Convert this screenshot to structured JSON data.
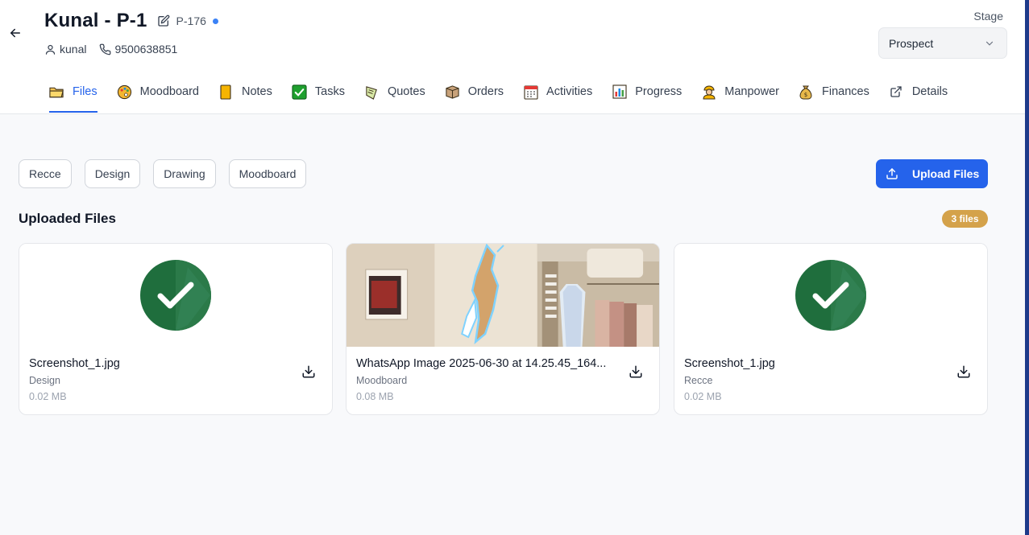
{
  "project": {
    "title": "Kunal - P-1",
    "code": "P-176",
    "user": "kunal",
    "phone": "9500638851"
  },
  "stage": {
    "label": "Stage",
    "value": "Prospect"
  },
  "tabs": [
    {
      "label": "Files",
      "icon": "folder-icon"
    },
    {
      "label": "Moodboard",
      "icon": "palette-icon"
    },
    {
      "label": "Notes",
      "icon": "note-icon"
    },
    {
      "label": "Tasks",
      "icon": "check-box-icon"
    },
    {
      "label": "Quotes",
      "icon": "quotes-icon"
    },
    {
      "label": "Orders",
      "icon": "package-icon"
    },
    {
      "label": "Activities",
      "icon": "calendar-icon"
    },
    {
      "label": "Progress",
      "icon": "bar-chart-icon"
    },
    {
      "label": "Manpower",
      "icon": "worker-icon"
    },
    {
      "label": "Finances",
      "icon": "money-bag-icon"
    },
    {
      "label": "Details",
      "icon": "external-link-icon"
    }
  ],
  "filters": [
    "Recce",
    "Design",
    "Drawing",
    "Moodboard"
  ],
  "upload_label": "Upload Files",
  "section_title": "Uploaded Files",
  "file_count": "3 files",
  "files": [
    {
      "name": "Screenshot_1.jpg",
      "category": "Design",
      "size": "0.02 MB",
      "thumb": "check-badge"
    },
    {
      "name": "WhatsApp Image 2025-06-30 at 14.25.45_164...",
      "category": "Moodboard",
      "size": "0.08 MB",
      "thumb": "photo"
    },
    {
      "name": "Screenshot_1.jpg",
      "category": "Recce",
      "size": "0.02 MB",
      "thumb": "check-badge"
    }
  ],
  "colors": {
    "accent": "#2563eb",
    "badge": "#d4a24a",
    "check": "#1f7a3f"
  }
}
